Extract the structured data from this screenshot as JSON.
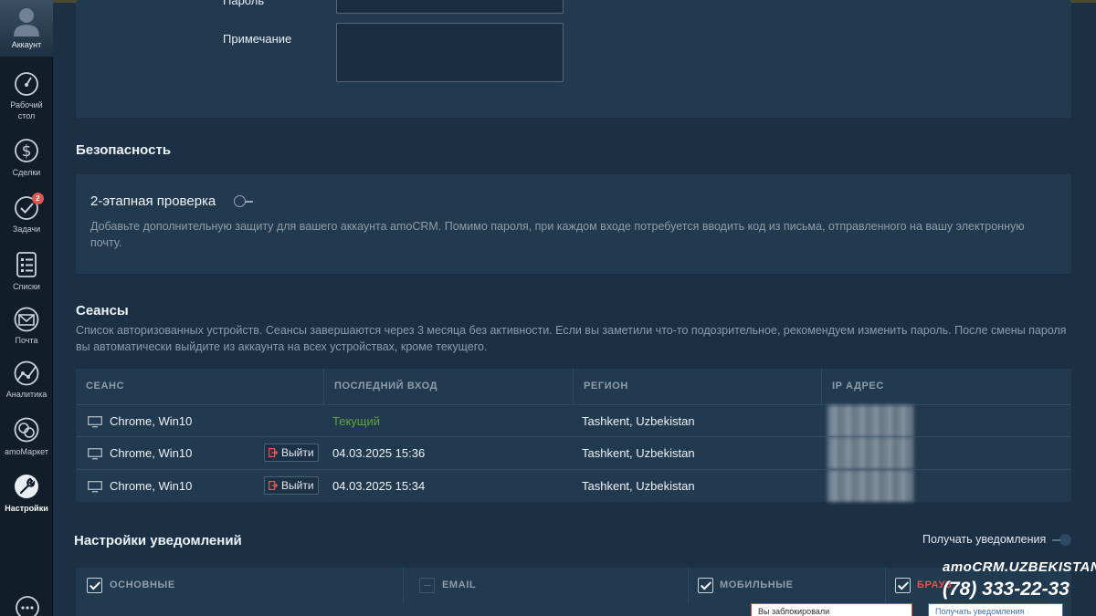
{
  "sidebar": {
    "account_label": "Аккаунт",
    "items": [
      {
        "label_line1": "Рабочий",
        "label_line2": "стол",
        "icon": "dashboard-gauge-icon"
      },
      {
        "label_line1": "Сделки",
        "icon": "dollar-icon"
      },
      {
        "label_line1": "Задачи",
        "icon": "checkmark-circle-icon",
        "badge": "2"
      },
      {
        "label_line1": "Списки",
        "icon": "list-icon"
      },
      {
        "label_line1": "Почта",
        "icon": "envelope-icon"
      },
      {
        "label_line1": "Аналитика",
        "icon": "analytics-chart-icon"
      },
      {
        "label_line1": "amoМаркет",
        "icon": "market-icon"
      },
      {
        "label_line1": "Настройки",
        "icon": "wrench-icon",
        "active": true
      }
    ]
  },
  "account_form": {
    "password_label": "Пароль",
    "note_label": "Примечание"
  },
  "security": {
    "title": "Безопасность",
    "two_step_title": "2-этапная проверка",
    "two_step_desc_line1": "Добавьте дополнительную защиту для вашего аккаунта amoCRM. Помимо пароля, при каждом входе потребуется вводить код из письма, отправленного на вашу электронную",
    "two_step_desc_line2": "почту."
  },
  "sessions": {
    "title": "Сеансы",
    "desc_line1": "Список авторизованных устройств. Сеансы завершаются через 3 месяца без активности. Если вы заметили что-то подозрительное, рекомендуем изменить пароль. После смены пароля",
    "desc_line2": "вы автоматически выйдите из аккаунта на всех устройствах, кроме текущего.",
    "columns": [
      "СЕАНС",
      "ПОСЛЕДНИЙ ВХОД",
      "РЕГИОН",
      "IP АДРЕС"
    ],
    "logout_label": "Выйти",
    "rows": [
      {
        "device": "Chrome, Win10",
        "last_login": "Текущий",
        "region": "Tashkent, Uzbekistan",
        "current": true
      },
      {
        "device": "Chrome, Win10",
        "last_login": "04.03.2025 15:36",
        "region": "Tashkent, Uzbekistan",
        "current": false
      },
      {
        "device": "Chrome, Win10",
        "last_login": "04.03.2025 15:34",
        "region": "Tashkent, Uzbekistan",
        "current": false
      }
    ]
  },
  "notifications": {
    "title": "Настройки уведомлений",
    "receive_label": "Получать уведомления",
    "columns": [
      {
        "label": "ОСНОВНЫЕ",
        "checked": true
      },
      {
        "label": "EMAIL",
        "checked": false
      },
      {
        "label": "МОБИЛЬНЫЕ",
        "checked": true
      },
      {
        "label": "БРАУЗ",
        "checked": true
      }
    ],
    "popup_blocked": "Вы заблокировали",
    "popup_receive": "Получать уведомления"
  },
  "watermark": {
    "brand": "amoCRM.UZBEKISTAN",
    "phone": "(78) 333-22-33"
  },
  "colors": {
    "background": "#1b3044",
    "panel": "#223a4f",
    "sidebar": "#111d29",
    "current_session": "#62a33d",
    "badge": "#e0554d"
  }
}
